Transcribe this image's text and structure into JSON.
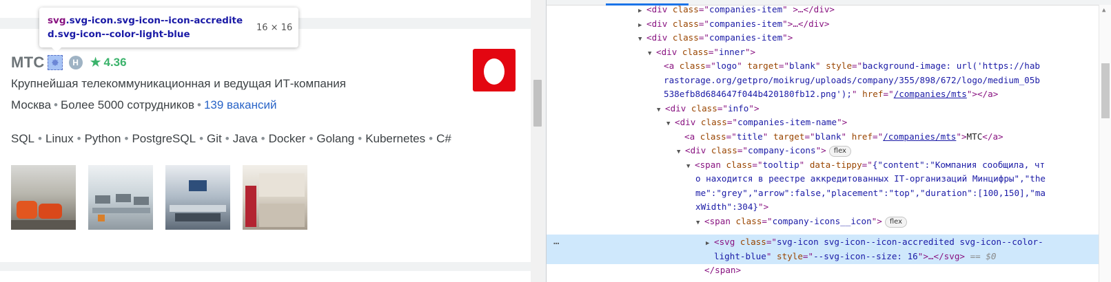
{
  "tooltip": {
    "selector_tag": "svg",
    "selector_classes_line1": ".svg-icon.svg-icon--icon-accredite",
    "selector_classes_line2": "d.svg-icon--color-light-blue",
    "dimensions": "16 × 16"
  },
  "company": {
    "name": "МТС",
    "rating_badge_letter": "H",
    "rating": "4.36",
    "description": "Крупнейшая телекоммуникационная и ведущая ИТ-компания",
    "city": "Москва",
    "employees": "Более 5000 сотрудников",
    "vacancies": "139 вакансий",
    "skills": [
      "SQL",
      "Linux",
      "Python",
      "PostgreSQL",
      "Git",
      "Java",
      "Docker",
      "Golang",
      "Kubernetes",
      "C#"
    ],
    "brand_color": "#e30611",
    "rating_color": "#3bb36b"
  },
  "devtools": {
    "line01_attr": "companies-item",
    "line01_tail": ">…</div>",
    "line02_attr": "companies-item",
    "line02_tail": ">…</div>",
    "line03_attr": "companies-item",
    "line04_attr": "inner",
    "line05_class": "logo",
    "line05_target": "blank",
    "line05_style_a": "background-image: url('https://hab",
    "line06_style_b": "rastorage.org/getpro/moikrug/uploads/company/355/898/672/logo/medium_05b",
    "line07_style_c": "538efb8d684647f044b420180fb12.png');",
    "line07_href": "/companies/mts",
    "line08_attr": "info",
    "line09_attr": "companies-item-name",
    "line10_class": "title",
    "line10_target": "blank",
    "line10_href": "/companies/mts",
    "line10_text": "МТС",
    "line11_attr": "company-icons",
    "line11_badge": "flex",
    "line12_class": "tooltip",
    "line12_tippy_a": "{\"content\":\"Компания сообщила, чт",
    "line13_tippy_b": "о находится в реестре аккредитованных IT-организаций Минцифры\",\"the",
    "line14_tippy_c": "me\":\"grey\",\"arrow\":false,\"placement\":\"top\",\"duration\":[100,150],\"ma",
    "line15_tippy_d": "xWidth\":304}",
    "line16_attr": "company-icons__icon",
    "line16_badge": "flex",
    "line17_class_a": "svg-icon svg-icon--icon-accredited svg-icon--color-",
    "line18_class_b": "light-blue",
    "line18_style": "--svg-icon--size: 16",
    "line18_eq": "== $0",
    "line19_close": "</span>",
    "dots": "…"
  }
}
